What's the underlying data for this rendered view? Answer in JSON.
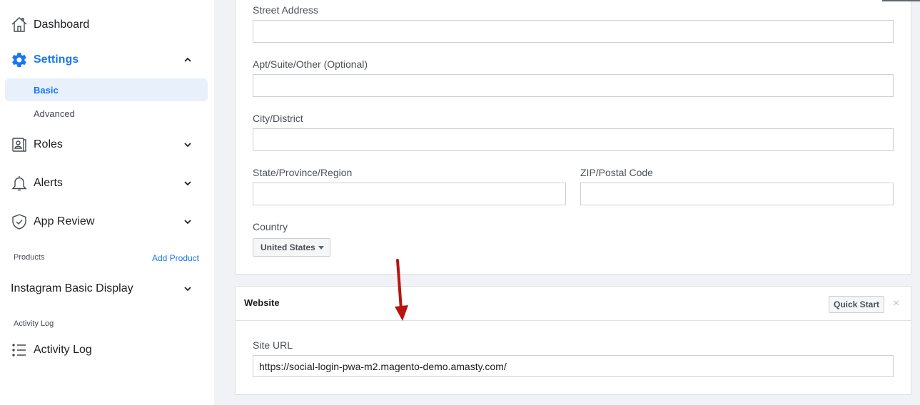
{
  "sidebar": {
    "dashboard": {
      "label": "Dashboard",
      "icon": "home-icon"
    },
    "settings": {
      "label": "Settings",
      "icon": "gear-icon",
      "expanded": true,
      "sub_items": [
        {
          "label": "Basic",
          "selected": true
        },
        {
          "label": "Advanced",
          "selected": false
        }
      ]
    },
    "roles": {
      "label": "Roles",
      "icon": "badge-icon"
    },
    "alerts": {
      "label": "Alerts",
      "icon": "bell-icon"
    },
    "app_review": {
      "label": "App Review",
      "icon": "shield-check-icon"
    },
    "products_section": {
      "label": "Products",
      "action": "Add Product"
    },
    "instagram": {
      "label": "Instagram Basic Display"
    },
    "activity_section": {
      "label": "Activity Log"
    },
    "activity_log": {
      "label": "Activity Log",
      "icon": "list-icon"
    }
  },
  "address_form": {
    "street": {
      "label": "Street Address",
      "value": ""
    },
    "apt": {
      "label": "Apt/Suite/Other (Optional)",
      "value": ""
    },
    "city": {
      "label": "City/District",
      "value": ""
    },
    "state": {
      "label": "State/Province/Region",
      "value": ""
    },
    "zip": {
      "label": "ZIP/Postal Code",
      "value": ""
    },
    "country": {
      "label": "Country",
      "value": "United States"
    }
  },
  "website_card": {
    "title": "Website",
    "quick_start": "Quick Start",
    "close": "×",
    "site_url": {
      "label": "Site URL",
      "value": "https://social-login-pwa-m2.magento-demo.amasty.com/"
    }
  },
  "colors": {
    "accent": "#1877f2",
    "annotation_arrow": "#b8150f"
  }
}
